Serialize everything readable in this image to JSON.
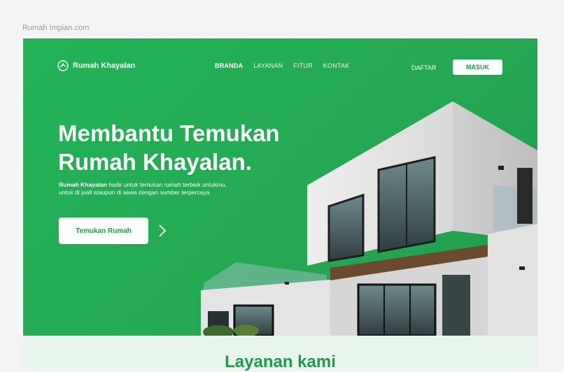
{
  "frame_label": "Rumah Impian.com",
  "brand": {
    "name": "Rumah Khayalan",
    "icon": "house-logo-icon"
  },
  "nav": {
    "items": [
      {
        "label": "BRANDA",
        "active": true
      },
      {
        "label": "LAYANAN",
        "active": false
      },
      {
        "label": "FITUR",
        "active": false
      },
      {
        "label": "KONTAK",
        "active": false
      }
    ]
  },
  "auth": {
    "register_label": "DAFTAR",
    "login_label": "MASUK"
  },
  "hero": {
    "headline_line1": "Membantu Temukan",
    "headline_line2": "Rumah Khayalan.",
    "desc_brand": "Rumah Khayalan",
    "desc_text": " hadir untuk temukan rumah terbaik untukmu, untuk di juall ataupun di sewa dengan sumber terpercaya",
    "cta_label": "Temukan Rumah",
    "cta_icon": "chevron-right-icon"
  },
  "services": {
    "title": "Layanan kami"
  },
  "colors": {
    "primary": "#22b457",
    "primary_dark": "#1f9a4b",
    "section_bg": "#e8f5ec"
  }
}
